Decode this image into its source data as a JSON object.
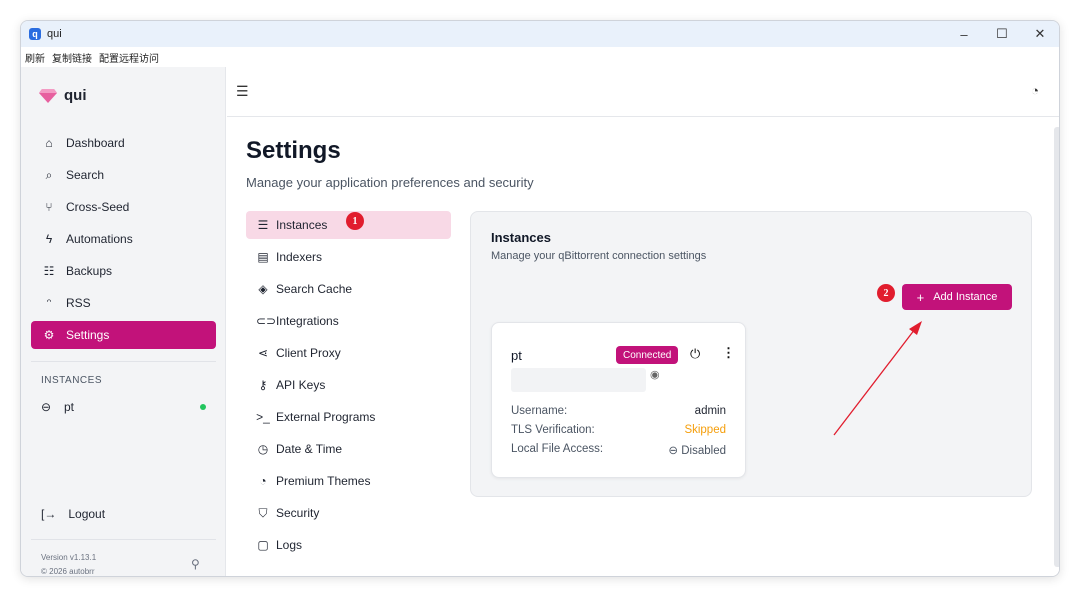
{
  "window": {
    "title": "qui",
    "controls": [
      "–",
      "☐",
      "✕"
    ]
  },
  "menubar": [
    "刷新",
    "复制链接",
    "配置远程访问"
  ],
  "sidebar": {
    "brand": "qui",
    "items": [
      {
        "label": "Dashboard",
        "icon": "home-icon",
        "glyph": "⌂"
      },
      {
        "label": "Search",
        "icon": "search-icon",
        "glyph": "⌕"
      },
      {
        "label": "Cross-Seed",
        "icon": "git-branch-icon",
        "glyph": "⑂"
      },
      {
        "label": "Automations",
        "icon": "zap-icon",
        "glyph": "ϟ"
      },
      {
        "label": "Backups",
        "icon": "archive-icon",
        "glyph": "☷"
      },
      {
        "label": "RSS",
        "icon": "rss-icon",
        "glyph": "ᵔ"
      },
      {
        "label": "Settings",
        "icon": "settings-icon",
        "glyph": "⚙"
      }
    ],
    "instances_heading": "INSTANCES",
    "instances": [
      {
        "label": "pt",
        "status_color": "#22c55e"
      }
    ],
    "logout": "Logout",
    "version": "Version v1.13.1",
    "copyright": "© 2026 autobrr"
  },
  "main": {
    "title": "Settings",
    "subtitle": "Manage your application preferences and security",
    "settings_nav": [
      {
        "label": "Instances",
        "icon": "server-icon",
        "glyph": "☰"
      },
      {
        "label": "Indexers",
        "icon": "database-icon",
        "glyph": "▤"
      },
      {
        "label": "Search Cache",
        "icon": "layers-icon",
        "glyph": "◈"
      },
      {
        "label": "Integrations",
        "icon": "link-icon",
        "glyph": "⊂⊃"
      },
      {
        "label": "Client Proxy",
        "icon": "share-icon",
        "glyph": "⋖"
      },
      {
        "label": "API Keys",
        "icon": "key-icon",
        "glyph": "⚷"
      },
      {
        "label": "External Programs",
        "icon": "terminal-icon",
        "glyph": ">_"
      },
      {
        "label": "Date & Time",
        "icon": "clock-icon",
        "glyph": "◷"
      },
      {
        "label": "Premium Themes",
        "icon": "palette-icon",
        "glyph": "◔"
      },
      {
        "label": "Security",
        "icon": "shield-icon",
        "glyph": "⛉"
      },
      {
        "label": "Logs",
        "icon": "file-text-icon",
        "glyph": "▢"
      }
    ],
    "annotation_1": "1",
    "annotation_2": "2",
    "panel": {
      "title": "Instances",
      "subtitle": "Manage your qBittorrent connection settings",
      "add_button": "Add Instance",
      "card": {
        "name": "pt",
        "status": "Connected",
        "rows": [
          {
            "label": "Username:",
            "value": "admin"
          },
          {
            "label": "TLS Verification:",
            "value": "Skipped"
          },
          {
            "label": "Local File Access:",
            "value": "⊖ Disabled"
          }
        ]
      }
    }
  },
  "colors": {
    "accent": "#c2127a",
    "accent_soft": "#f8d9e6",
    "warning": "#f59e0b",
    "online": "#22c55e",
    "annotation": "#e11d2e"
  }
}
